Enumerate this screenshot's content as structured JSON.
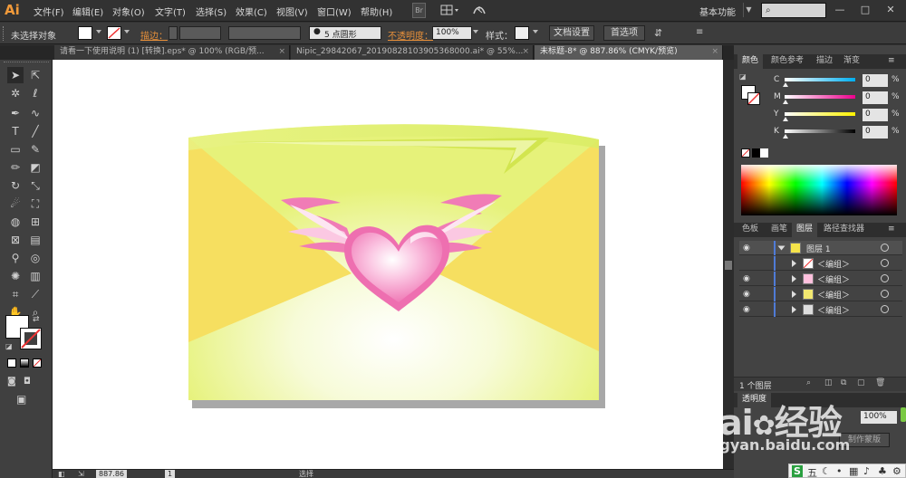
{
  "app": {
    "logo": "Ai",
    "workspace": "基本功能"
  },
  "menu": [
    "文件(F)",
    "编辑(E)",
    "对象(O)",
    "文字(T)",
    "选择(S)",
    "效果(C)",
    "视图(V)",
    "窗口(W)",
    "帮助(H)"
  ],
  "menubar_icons": {
    "bridge": "Br",
    "arrange": "arrange-documents-icon",
    "gpu": "gpu-performance-icon"
  },
  "controlbar": {
    "selection_status": "未选择对象",
    "stroke_label": "描边：",
    "brush_label": "5 点圆形",
    "opacity_label": "不透明度：",
    "opacity_value": "100%",
    "style_label": "样式：",
    "doc_setup": "文档设置",
    "preferences": "首选项"
  },
  "tabs": [
    {
      "label": "请看一下使用说明 (1) [转换].eps* @ 100% (RGB/预...",
      "close": "×",
      "active": false
    },
    {
      "label": "Nipic_29842067_20190828103905368000.ai* @ 55%...",
      "close": "×",
      "active": false
    },
    {
      "label": "未标题-8* @ 887.86% (CMYK/预览)",
      "close": "×",
      "active": true
    }
  ],
  "color_panel": {
    "tabs": [
      "颜色",
      "颜色参考",
      "描边",
      "渐变"
    ],
    "channels": [
      {
        "label": "C",
        "value": "0",
        "unit": "%",
        "gradient": "#00aeef"
      },
      {
        "label": "M",
        "value": "0",
        "unit": "%",
        "gradient": "#ec008c"
      },
      {
        "label": "Y",
        "value": "0",
        "unit": "%",
        "gradient": "#fff200"
      },
      {
        "label": "K",
        "value": "0",
        "unit": "%",
        "gradient": "#000000"
      }
    ]
  },
  "layers_panel": {
    "tabs": [
      "色板",
      "画笔",
      "图层",
      "路径查找器"
    ],
    "layers": [
      {
        "name": "图层 1",
        "indent": 0,
        "swatch": "#f5e34a"
      },
      {
        "name": "＜编组＞",
        "indent": 1,
        "swatch": "#ff88bb"
      },
      {
        "name": "＜编组＞",
        "indent": 1,
        "swatch": "#ffc0dd"
      },
      {
        "name": "＜编组＞",
        "indent": 1,
        "swatch": "#f2e870"
      },
      {
        "name": "＜编组＞",
        "indent": 1,
        "swatch": "#dddddd"
      }
    ],
    "footer_count": "1 个图层"
  },
  "lower_panel": {
    "tab": "透明度",
    "opacity": "100%",
    "mask_button": "制作蒙版"
  },
  "statusbar": {
    "zoom": "887.86",
    "page": "1",
    "tool": "选择"
  },
  "watermark": {
    "logo_text": "Bai",
    "logo_text2": "经验",
    "url": "jingyan.baidu.com"
  },
  "ime": {
    "s": "S",
    "five": "五",
    "moon": "☾",
    "dot": "•",
    "grid": "▦",
    "mic": "♪",
    "shirt": "♣",
    "gear": "⚙"
  },
  "colors": {
    "envelope_back": "#e4f170",
    "envelope_flap": "#f5df5f",
    "heart": "#f07cb6",
    "accent": "#e8903a"
  }
}
